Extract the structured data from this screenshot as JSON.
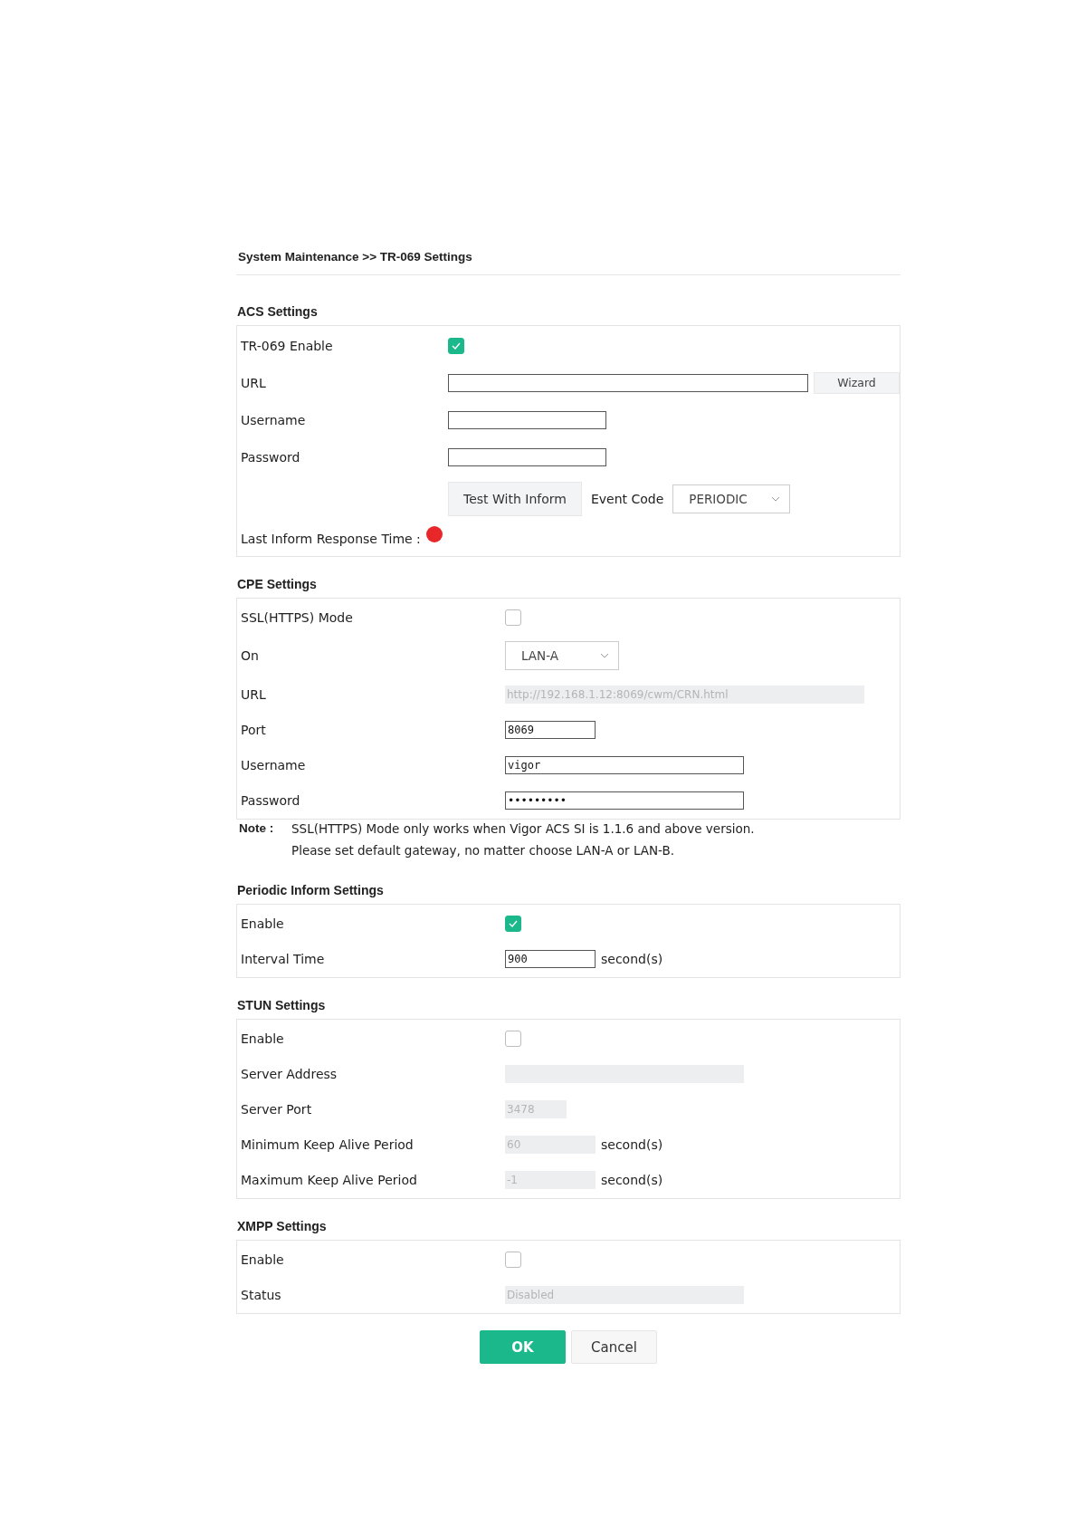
{
  "breadcrumb": "System Maintenance >> TR-069 Settings",
  "sections": [
    {
      "title": "ACS Settings",
      "rows": [
        {
          "kind": "checkbox",
          "label": "TR-069 Enable",
          "checked": true
        },
        {
          "kind": "input",
          "label": "URL",
          "button": "Wizard"
        },
        {
          "kind": "input",
          "label": "Username"
        },
        {
          "kind": "input",
          "label": "Password"
        },
        {
          "kind": "test",
          "button": "Test With Inform",
          "select_label": "Event Code",
          "select_value": "PERIODIC"
        },
        {
          "kind": "status",
          "label": "Last Inform Response Time :",
          "color": "#e8272a"
        }
      ]
    },
    {
      "title": "CPE Settings",
      "rows": [
        {
          "kind": "checkbox",
          "label": "SSL(HTTPS) Mode",
          "checked": false
        },
        {
          "kind": "select",
          "label": "On",
          "value": "LAN-A"
        },
        {
          "kind": "input",
          "label": "URL",
          "value": "http://192.168.1.12:8069/cwm/CRN.html",
          "disabled": true
        },
        {
          "kind": "input",
          "label": "Port",
          "value": "8069",
          "disabled": false
        },
        {
          "kind": "input",
          "label": "Username",
          "value": "vigor",
          "disabled": false
        },
        {
          "kind": "input",
          "label": "Password",
          "value": "•••••••••",
          "disabled": false
        }
      ],
      "note": {
        "label": "Note :",
        "lines": [
          "SSL(HTTPS) Mode only works when Vigor ACS SI is 1.1.6 and above version.",
          "Please set default gateway, no matter choose LAN-A or LAN-B."
        ]
      }
    },
    {
      "title": "Periodic Inform Settings",
      "rows": [
        {
          "kind": "checkbox",
          "label": "Enable",
          "checked": true
        },
        {
          "kind": "input",
          "label": "Interval Time",
          "value": "900",
          "disabled": false,
          "unit": "second(s)"
        }
      ]
    },
    {
      "title": "STUN Settings",
      "rows": [
        {
          "kind": "checkbox",
          "label": "Enable",
          "checked": false
        },
        {
          "kind": "input",
          "label": "Server Address",
          "disabled": true
        },
        {
          "kind": "input",
          "label": "Server Port",
          "value": "3478",
          "disabled": true
        },
        {
          "kind": "input",
          "label": "Minimum Keep Alive Period",
          "value": "60",
          "disabled": true,
          "unit": "second(s)"
        },
        {
          "kind": "input",
          "label": "Maximum Keep Alive Period",
          "value": "-1",
          "disabled": true,
          "unit": "second(s)"
        }
      ]
    },
    {
      "title": "XMPP Settings",
      "rows": [
        {
          "kind": "checkbox",
          "label": "Enable",
          "checked": false
        },
        {
          "kind": "input",
          "label": "Status",
          "value": "Disabled",
          "disabled": true
        }
      ]
    }
  ],
  "buttons": [
    {
      "label": "OK",
      "kind": "primary"
    },
    {
      "label": "Cancel",
      "kind": "secondary"
    }
  ]
}
